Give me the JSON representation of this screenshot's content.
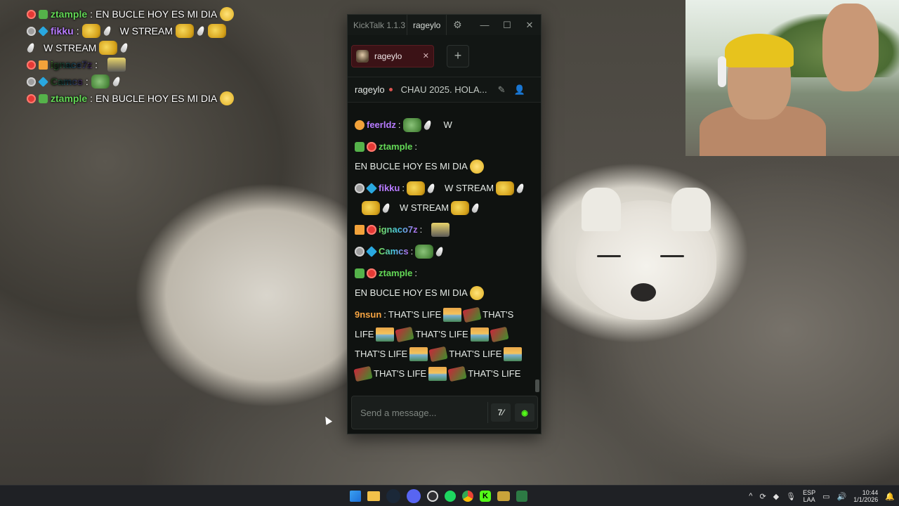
{
  "overlay_chat": [
    {
      "user": "ztample",
      "message": "EN BUCLE HOY ES MI DIA"
    },
    {
      "user": "fikku",
      "message": "W STREAM"
    },
    {
      "user": "",
      "message": "W STREAM"
    },
    {
      "user": "ignace7z",
      "message": ""
    },
    {
      "user": "Camcs",
      "message": ""
    },
    {
      "user": "ztample",
      "message": "EN BUCLE HOY ES MI DIA"
    }
  ],
  "kicktalk": {
    "app_title": "KickTalk 1.1.3",
    "titlebar_user": "rageylo",
    "tab_label": "rageylo",
    "add_tab": "+",
    "stream_channel": "rageylo",
    "stream_title": "CHAU 2025. HOLA...",
    "messages": [
      {
        "user": "feerldz",
        "text": "W"
      },
      {
        "user": "ztample",
        "text": "EN BUCLE HOY ES MI DIA"
      },
      {
        "user": "fikku",
        "text1": "W STREAM",
        "text2": "W STREAM"
      },
      {
        "user": "ignaco7z",
        "text": ""
      },
      {
        "user": "Camcs",
        "text": ""
      },
      {
        "user": "ztample",
        "text": "EN BUCLE HOY ES MI DIA"
      },
      {
        "user": "9nsun",
        "segments": [
          "THAT'S LIFE",
          "THAT'S",
          "LIFE",
          "THAT'S LIFE",
          "THAT'S LIFE",
          "THAT'S LIFE",
          "THAT'S LIFE",
          "THAT'S LIFE"
        ]
      }
    ],
    "input_placeholder": "Send a message...",
    "emote_button": "7tv",
    "kick_button": "kick"
  },
  "taskbar": {
    "lang_top": "ESP",
    "lang_bottom": "LAA",
    "time": "10:44",
    "date": "1/1/2026"
  },
  "colors": {
    "kick_green": "#53fc18",
    "tab_red": "#3b1216",
    "window_bg": "#0f1210"
  }
}
